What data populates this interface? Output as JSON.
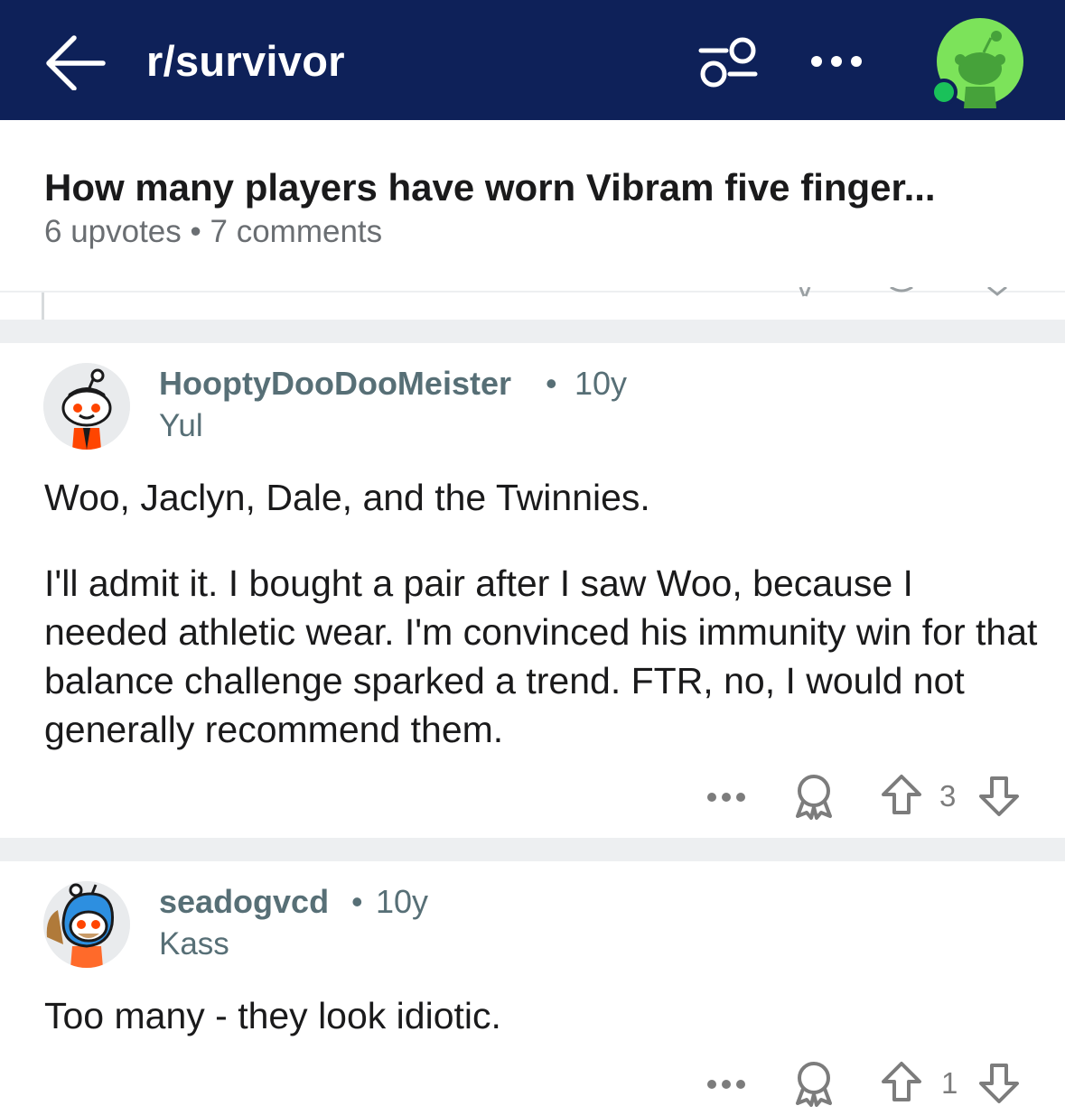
{
  "header": {
    "subreddit": "r/survivor",
    "back_icon": "arrow-left-icon",
    "filter_icon": "sliders-icon",
    "more_icon": "more-horizontal-icon",
    "colors": {
      "bar": "#0e2159",
      "avatar": "#7ce35a",
      "online": "#1ac15a"
    }
  },
  "post": {
    "title": "How many players have worn Vibram five finger...",
    "upvotes": "6 upvotes",
    "separator": "•",
    "comments": "7 comments"
  },
  "comments": [
    {
      "username": "HooptyDooDooMeister",
      "dot": "•",
      "age": "10y",
      "flair": "Yul",
      "paragraphs": [
        "Woo, Jaclyn, Dale, and the Twinnies.",
        "I'll admit it. I bought a pair after I saw Woo, because I needed athletic wear. I'm convinced his immunity win for that balance challenge sparked a trend. FTR, no, I would not generally recommend them."
      ],
      "votes": "3"
    },
    {
      "username": "seadogvcd",
      "dot": "•",
      "age": "10y",
      "flair": "Kass",
      "paragraphs": [
        "Too many - they look idiotic."
      ],
      "votes": "1"
    }
  ]
}
